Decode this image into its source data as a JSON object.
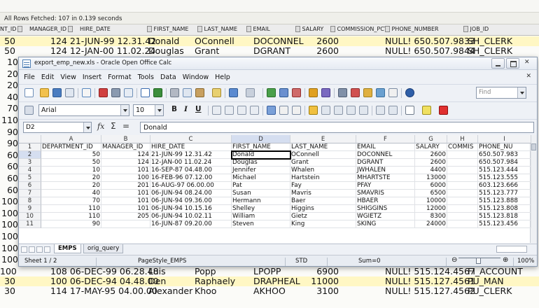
{
  "sqlresults": {
    "status_text": "All Rows Fetched: 107 in 0.139 seconds",
    "headers": [
      "NT_ID",
      "MANAGER_ID",
      "HIRE_DATE",
      "FIRST_NAME",
      "LAST_NAME",
      "EMAIL",
      "SALARY",
      "COMMISSION_PCT",
      "PHONE_NUMBER",
      "JOB_ID"
    ],
    "rows_top": [
      {
        "dept": "50",
        "mgr_date": "124 21-JUN-99 12.31.42",
        "first": "Donald",
        "last": "OConnell",
        "email": "DOCONNEL",
        "salary": "2600",
        "phone": "NULL! 650.507.9833",
        "job": "SH_CLERK"
      },
      {
        "dept": "50",
        "mgr_date": "124 12-JAN-00 11.02.24",
        "first": "Douglas",
        "last": "Grant",
        "email": "DGRANT",
        "salary": "2600",
        "phone": "NULL! 650.507.9844",
        "job": "SH_CLERK"
      }
    ],
    "left_numbers": [
      "10",
      "20",
      "20",
      "40",
      "70",
      "110",
      "90",
      "90",
      "60",
      "60",
      "60",
      "60",
      "100",
      "100",
      "100",
      "100",
      "100",
      "100"
    ],
    "rows_bottom": [
      {
        "dept": "100",
        "mgr_date": "108 06-DEC-99 06.28.48",
        "first": "Luis",
        "last": "Popp",
        "email": "LPOPP",
        "salary": "6900",
        "phone": "NULL! 515.124.4567",
        "job": "FI_ACCOUNT"
      },
      {
        "dept": "30",
        "mgr_date": "100 06-DEC-94 04.48.00",
        "first": "Den",
        "last": "Raphaely",
        "email": "DRAPHEAL",
        "salary": "11000",
        "phone": "NULL! 515.127.4561",
        "job": "PU_MAN"
      },
      {
        "dept": "30",
        "mgr_date": "114 17-MAY-95 04.00.00",
        "first": "Alexander",
        "last": "Khoo",
        "email": "AKHOO",
        "salary": "3100",
        "phone": "NULL! 515.127.4562",
        "job": "PU_CLERK"
      }
    ]
  },
  "calc": {
    "title": "export_emp_new.xls - Oracle Open Office Calc",
    "menu": [
      "File",
      "Edit",
      "View",
      "Insert",
      "Format",
      "Tools",
      "Data",
      "Window",
      "Help"
    ],
    "find_placeholder": "Find",
    "font_name": "Arial",
    "font_size": "10",
    "cell_ref": "D2",
    "formula_value": "Donald",
    "columns": [
      {
        "letter": "A",
        "header": "DEPARTMENT_ID"
      },
      {
        "letter": "B",
        "header": "MANAGER_ID"
      },
      {
        "letter": "C",
        "header": "HIRE_DATE"
      },
      {
        "letter": "D",
        "header": "FIRST_NAME"
      },
      {
        "letter": "E",
        "header": "LAST_NAME"
      },
      {
        "letter": "F",
        "header": "EMAIL"
      },
      {
        "letter": "G",
        "header": "SALARY"
      },
      {
        "letter": "H",
        "header": "COMMIS"
      },
      {
        "letter": "I",
        "header": "PHONE_NU"
      }
    ],
    "rows": [
      {
        "n": "2",
        "a": "50",
        "b": "124",
        "c": "21-JUN-99 12.31.42",
        "d": "Donald",
        "e": "OConnell",
        "f": "DOCONNEL",
        "g": "2600",
        "i": "650.507.983"
      },
      {
        "n": "3",
        "a": "50",
        "b": "124",
        "c": "12-JAN-00 11.02.24",
        "d": "Douglas",
        "e": "Grant",
        "f": "DGRANT",
        "g": "2600",
        "i": "650.507.984"
      },
      {
        "n": "4",
        "a": "10",
        "b": "101",
        "c": "16-SEP-87 04.48.00",
        "d": "Jennifer",
        "e": "Whalen",
        "f": "JWHALEN",
        "g": "4400",
        "i": "515.123.444"
      },
      {
        "n": "5",
        "a": "20",
        "b": "100",
        "c": "16-FEB-96 07.12.00",
        "d": "Michael",
        "e": "Hartstein",
        "f": "MHARTSTE",
        "g": "13000",
        "i": "515.123.555"
      },
      {
        "n": "6",
        "a": "20",
        "b": "201",
        "c": "16-AUG-97 06.00.00",
        "d": "Pat",
        "e": "Fay",
        "f": "PFAY",
        "g": "6000",
        "i": "603.123.666"
      },
      {
        "n": "7",
        "a": "40",
        "b": "101",
        "c": "06-JUN-94 08.24.00",
        "d": "Susan",
        "e": "Mavris",
        "f": "SMAVRIS",
        "g": "6500",
        "i": "515.123.777"
      },
      {
        "n": "8",
        "a": "70",
        "b": "101",
        "c": "06-JUN-94 09.36.00",
        "d": "Hermann",
        "e": "Baer",
        "f": "HBAER",
        "g": "10000",
        "i": "515.123.888"
      },
      {
        "n": "9",
        "a": "110",
        "b": "101",
        "c": "06-JUN-94 10.15.16",
        "d": "Shelley",
        "e": "Higgins",
        "f": "SHIGGINS",
        "g": "12000",
        "i": "515.123.808"
      },
      {
        "n": "10",
        "a": "110",
        "b": "205",
        "c": "06-JUN-94 10.02.11",
        "d": "William",
        "e": "Gietz",
        "f": "WGIETZ",
        "g": "8300",
        "i": "515.123.818"
      },
      {
        "n": "11",
        "a": "90",
        "b": "",
        "c": "16-JUN-87 09.20.00",
        "d": "Steven",
        "e": "King",
        "f": "SKING",
        "g": "24000",
        "i": "515.123.456"
      }
    ],
    "tabs": [
      "EMPS",
      "orig_query"
    ],
    "status": {
      "sheet": "Sheet 1 / 2",
      "page_style": "PageStyle_EMPS",
      "mode": "STD",
      "sum": "Sum=0",
      "zoom": "100%"
    }
  }
}
